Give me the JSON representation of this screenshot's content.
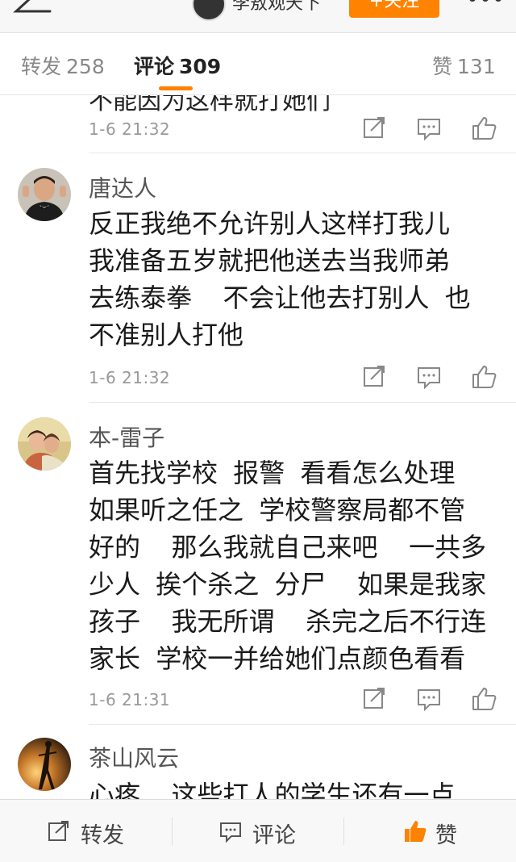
{
  "header": {
    "author_name": "李敖观天下",
    "follow_label": "+关注",
    "icons": [
      "back-icon",
      "more-icon"
    ]
  },
  "tabs": [
    {
      "label": "转发",
      "count": "258"
    },
    {
      "label": "评论",
      "count": "309",
      "active": true
    },
    {
      "label": "赞",
      "count": "131"
    }
  ],
  "comments": [
    {
      "username": "",
      "text": "不能因为这样就打她们",
      "time": "1-6 21:32"
    },
    {
      "username": "唐达人",
      "text": "反正我绝不允许别人这样打我儿\n我准备五岁就把他送去当我师弟\n去练泰拳  不会让他去打别人 也\n不准别人打他",
      "time": "1-6 21:32"
    },
    {
      "username": "本-雷子",
      "text": "首先找学校 报警 看看怎么处理\n如果听之任之 学校警察局都不管\n好的  那么我就自己来吧  一共多\n少人 挨个杀之 分尸  如果是我家\n孩子  我无所谓  杀完之后不行连\n家长 学校一并给她们点颜色看看",
      "time": "1-6 21:31"
    },
    {
      "username": "茶山风云",
      "text": "心疼  这些打人的学生还有一点",
      "time": ""
    }
  ],
  "comment_actions": [
    "share-icon",
    "comment-icon",
    "like-icon"
  ],
  "bottom_bar": {
    "repost_label": "转发",
    "comment_label": "评论",
    "like_label": "赞"
  },
  "colors": {
    "accent": "#ff8200",
    "text_primary": "#1a1a1a",
    "text_secondary": "#999999"
  }
}
